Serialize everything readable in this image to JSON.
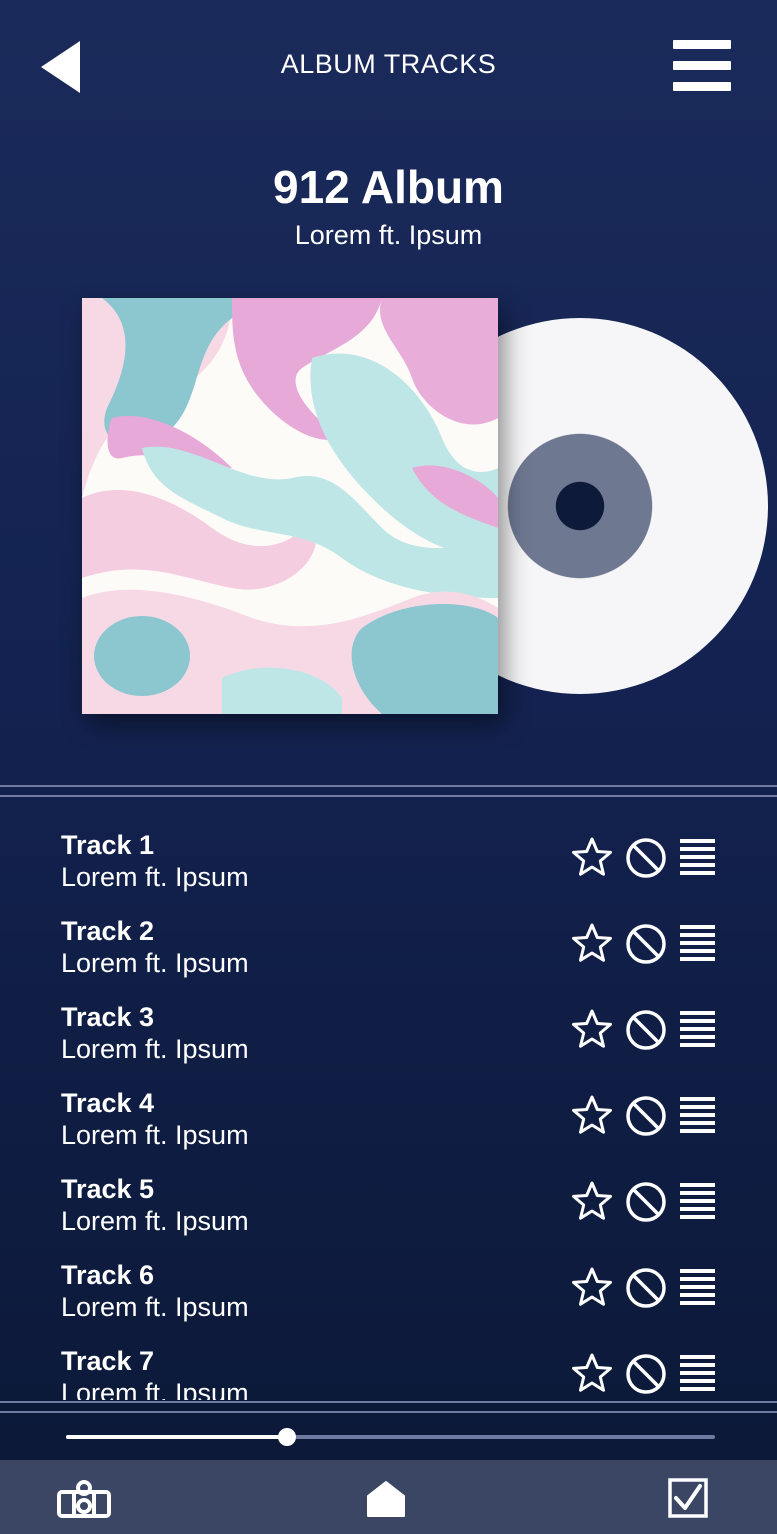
{
  "header": {
    "title": "ALBUM TRACKS",
    "back_icon": "back-triangle-icon",
    "menu_icon": "hamburger-menu-icon"
  },
  "album": {
    "title": "912 Album",
    "artist": "Lorem ft. Ipsum"
  },
  "tracks": [
    {
      "title": "Track 1",
      "artist": "Lorem ft. Ipsum"
    },
    {
      "title": "Track 2",
      "artist": "Lorem ft. Ipsum"
    },
    {
      "title": "Track 3",
      "artist": "Lorem ft. Ipsum"
    },
    {
      "title": "Track 4",
      "artist": "Lorem ft. Ipsum"
    },
    {
      "title": "Track 5",
      "artist": "Lorem ft. Ipsum"
    },
    {
      "title": "Track 6",
      "artist": "Lorem ft. Ipsum"
    },
    {
      "title": "Track 7",
      "artist": "Lorem ft. Ipsum"
    }
  ],
  "track_action_icons": [
    "star-icon",
    "block-icon",
    "queue-icon"
  ],
  "player": {
    "progress_fraction": 0.34
  },
  "bottom_nav": {
    "items": [
      "library-icon",
      "home-icon",
      "checkbox-icon"
    ]
  },
  "colors": {
    "background_top": "#1a2a5a",
    "background_bottom": "#0b1836",
    "divider": "#6f7aa3",
    "nav_bar": "#3a4663",
    "text": "#ffffff"
  }
}
